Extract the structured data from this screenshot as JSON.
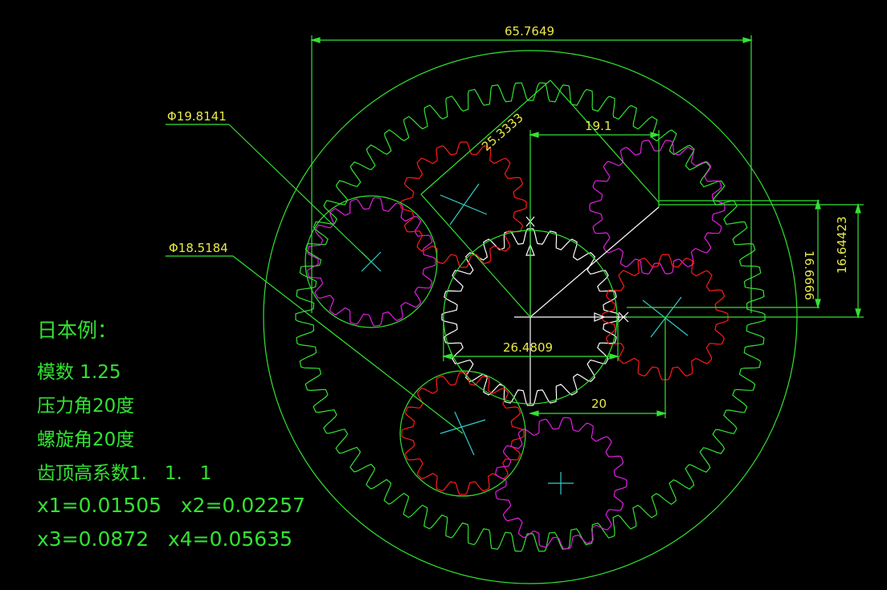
{
  "dimensions": {
    "overall_width": "65.7649",
    "center_distance_diag": "25.3333",
    "offset_top": "19.1",
    "vertical_a": "16.6666",
    "vertical_b": "16.64423",
    "sun_width": "26.4809",
    "offset_bottom": "20",
    "diameter_upper": "Φ19.8141",
    "diameter_lower": "Φ18.5184"
  },
  "notes": {
    "title": "日本例：",
    "module": "模数 1.25",
    "pressure_angle": "压力角20度",
    "helix_angle": "螺旋角20度",
    "addendum": "齿顶高系数1.   1.   1",
    "x12": "x1=0.01505   x2=0.02257",
    "x34": "x3=0.0872   x4=0.05635"
  },
  "colors": {
    "background": "#000000",
    "ring_gear": "#33e233",
    "red_gear": "#ff1a1a",
    "magenta_gear": "#e020e0",
    "sun_gear": "#ffffff",
    "center_mark": "#33cccc",
    "dimension_text": "#e8e84a",
    "note_text": "#33e233"
  }
}
